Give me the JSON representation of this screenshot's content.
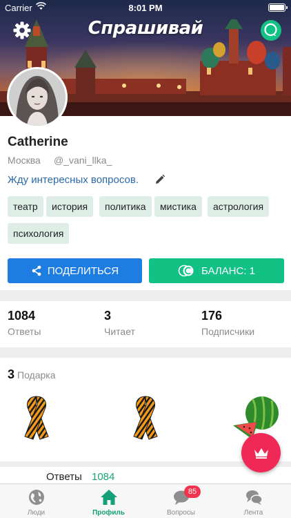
{
  "status_bar": {
    "carrier": "Carrier",
    "time": "8:01 PM"
  },
  "header": {
    "app_title": "Спрашивай"
  },
  "profile": {
    "name": "Catherine",
    "city": "Москва",
    "username": "@_vani_llka_",
    "status": "Жду интересных вопросов.",
    "tags": [
      "театр",
      "история",
      "политика",
      "мистика",
      "астрология",
      "психология"
    ]
  },
  "actions": {
    "share_label": "ПОДЕЛИТЬСЯ",
    "balance_label": "БАЛАНС: 1"
  },
  "stats": [
    {
      "value": "1084",
      "label": "Ответы"
    },
    {
      "value": "3",
      "label": "Читает"
    },
    {
      "value": "176",
      "label": "Подписчики"
    }
  ],
  "gifts": {
    "count": "3",
    "label": "Подарка",
    "items": [
      "ribbon-icon",
      "ribbon-icon",
      "watermelon-icon"
    ]
  },
  "answers": {
    "label": "Ответы",
    "count": "1084"
  },
  "tabbar": {
    "tabs": [
      {
        "label": "Люди",
        "icon": "globe-icon"
      },
      {
        "label": "Профиль",
        "icon": "home-icon"
      },
      {
        "label": "Вопросы",
        "icon": "chat-bubble-icon",
        "badge": "85"
      },
      {
        "label": "Лента",
        "icon": "chat-bubbles-icon"
      }
    ]
  },
  "colors": {
    "accent_green": "#12c184",
    "share_blue": "#1e7de0",
    "fab_red": "#f02856",
    "link_blue": "#2a6aa9"
  }
}
